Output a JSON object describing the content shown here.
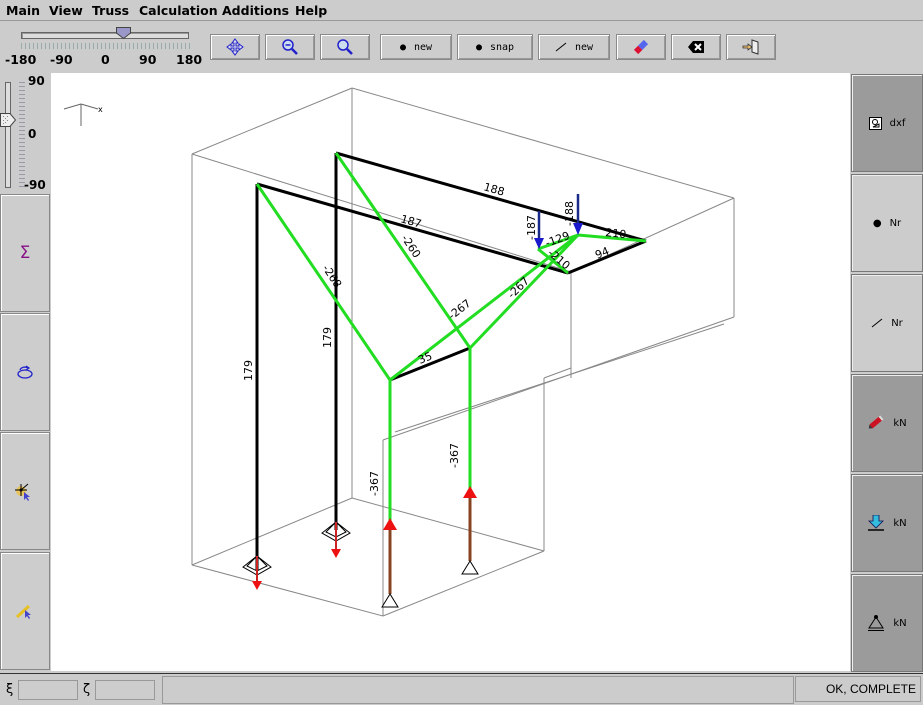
{
  "menu": [
    "Main",
    "View",
    "Truss",
    "Calculation",
    "Additions",
    "Help"
  ],
  "toolbar": {
    "rotation_slider": {
      "value_deg": 40,
      "min": -180,
      "max": 180,
      "labels": [
        "-180",
        "-90",
        "0",
        "90",
        "180"
      ]
    },
    "buttons": [
      {
        "icon": "move-icon",
        "label": ""
      },
      {
        "icon": "zoom-out-icon",
        "label": ""
      },
      {
        "icon": "zoom-in-icon",
        "label": ""
      },
      {
        "icon": "node-icon",
        "label": "new"
      },
      {
        "icon": "node-icon",
        "label": "snap"
      },
      {
        "icon": "member-icon",
        "label": "new"
      },
      {
        "icon": "eraser-icon",
        "label": ""
      },
      {
        "icon": "delete-icon",
        "label": ""
      },
      {
        "icon": "exit-icon",
        "label": ""
      }
    ]
  },
  "left_panel": {
    "tilt_slider": {
      "value_deg": 0,
      "min": -90,
      "max": 90,
      "labels": [
        "90",
        "0",
        "-90"
      ]
    },
    "buttons": [
      {
        "icon": "sigma-icon",
        "glyph": "Σ"
      },
      {
        "icon": "rotate-icon",
        "glyph": ""
      },
      {
        "icon": "select-node-icon",
        "glyph": ""
      },
      {
        "icon": "select-member-icon",
        "glyph": ""
      }
    ]
  },
  "right_panel": {
    "buttons": [
      {
        "icon": "dxf-export-icon",
        "label": "dxf",
        "active": true
      },
      {
        "icon": "node-number-icon",
        "label": "Nr",
        "active": false
      },
      {
        "icon": "member-number-icon",
        "label": "Nr",
        "active": false
      },
      {
        "icon": "member-force-icon",
        "label": "kN",
        "active": true
      },
      {
        "icon": "load-icon",
        "label": "kN",
        "active": true
      },
      {
        "icon": "support-reaction-icon",
        "label": "kN",
        "active": true
      }
    ]
  },
  "canvas": {
    "axis_label": "x",
    "member_labels": [
      "188",
      "187",
      "-260",
      "-268",
      "179",
      "179",
      "-187",
      "-188",
      "-129",
      "-210",
      "210",
      "94",
      "-267",
      "-267",
      "35",
      "-367",
      "-367"
    ]
  },
  "status": {
    "xi_label": "ξ",
    "xi_value": "",
    "zeta_label": "ζ",
    "zeta_value": "",
    "message": "OK, COMPLETE"
  },
  "colors": {
    "compression": "#22dd22",
    "tension": "#000000",
    "load": "#1a1acc",
    "reaction": "#ee1111"
  }
}
